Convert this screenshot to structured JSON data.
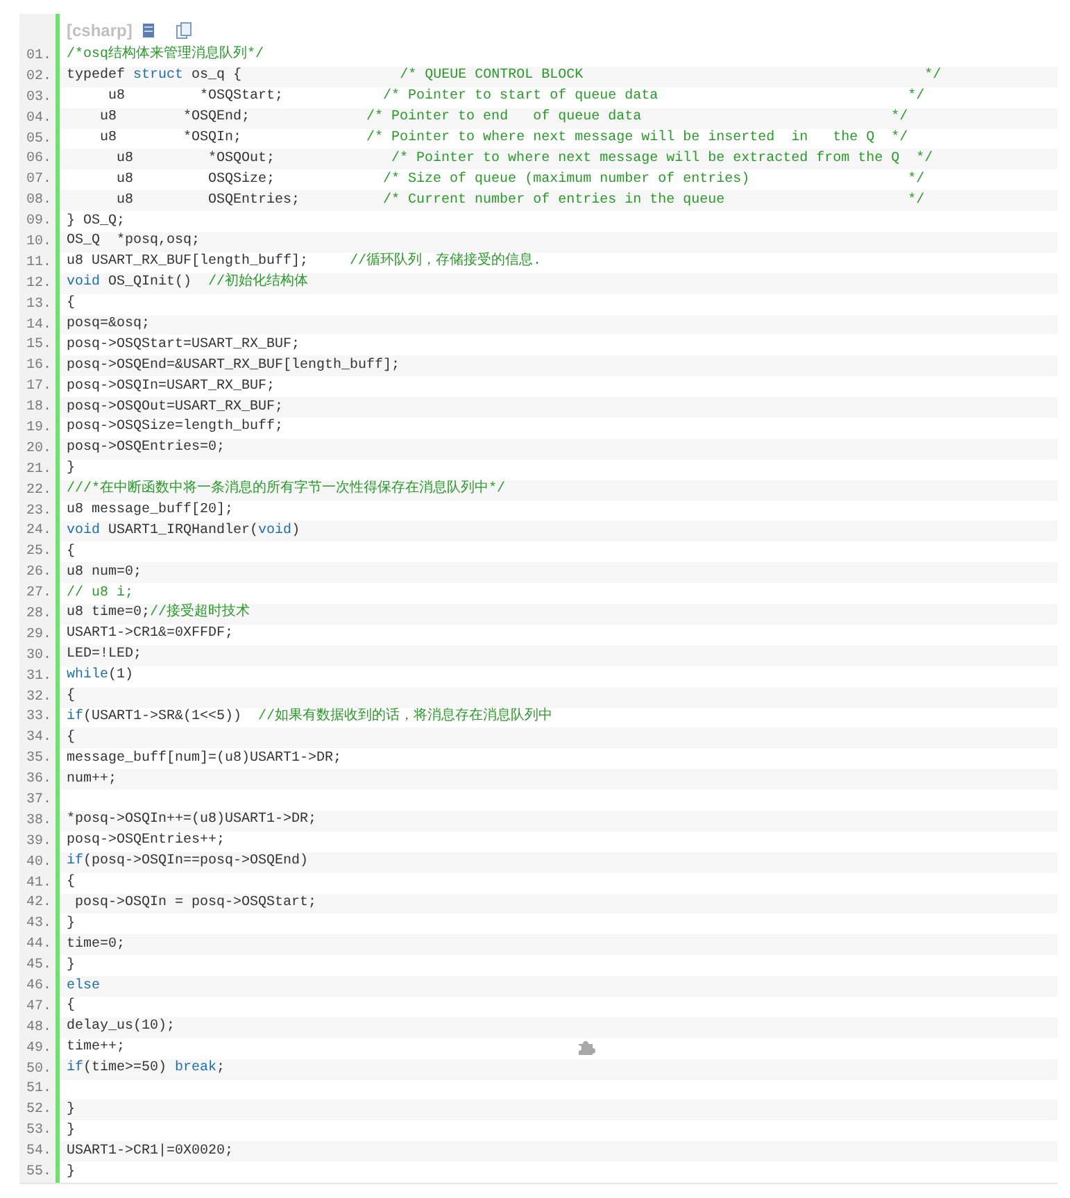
{
  "code_block": {
    "language": "[csharp]",
    "lines": [
      {
        "number": "01.",
        "tokens": [
          {
            "kind": "comment",
            "text": "/*osq结构体来管理消息队列*/"
          }
        ]
      },
      {
        "number": "02.",
        "tokens": [
          {
            "kind": "plain",
            "text": "typedef "
          },
          {
            "kind": "keyword",
            "text": "struct"
          },
          {
            "kind": "plain",
            "text": " os_q {                   "
          },
          {
            "kind": "comment",
            "text": "/* QUEUE CONTROL BLOCK                                         */"
          }
        ]
      },
      {
        "number": "03.",
        "tokens": [
          {
            "kind": "plain",
            "text": "     u8         *OSQStart;            "
          },
          {
            "kind": "comment",
            "text": "/* Pointer to start of queue data                              */"
          }
        ]
      },
      {
        "number": "04.",
        "tokens": [
          {
            "kind": "plain",
            "text": "    u8        *OSQEnd;              "
          },
          {
            "kind": "comment",
            "text": "/* Pointer to end   of queue data                              */"
          }
        ]
      },
      {
        "number": "05.",
        "tokens": [
          {
            "kind": "plain",
            "text": "    u8        *OSQIn;               "
          },
          {
            "kind": "comment",
            "text": "/* Pointer to where next message will be inserted  in   the Q  */"
          }
        ]
      },
      {
        "number": "06.",
        "tokens": [
          {
            "kind": "plain",
            "text": "      u8         *OSQOut;              "
          },
          {
            "kind": "comment",
            "text": "/* Pointer to where next message will be extracted from the Q  */"
          }
        ]
      },
      {
        "number": "07.",
        "tokens": [
          {
            "kind": "plain",
            "text": "      u8         OSQSize;             "
          },
          {
            "kind": "comment",
            "text": "/* Size of queue (maximum number of entries)                   */"
          }
        ]
      },
      {
        "number": "08.",
        "tokens": [
          {
            "kind": "plain",
            "text": "      u8         OSQEntries;          "
          },
          {
            "kind": "comment",
            "text": "/* Current number of entries in the queue                      */"
          }
        ]
      },
      {
        "number": "09.",
        "tokens": [
          {
            "kind": "plain",
            "text": "} OS_Q;"
          }
        ]
      },
      {
        "number": "10.",
        "tokens": [
          {
            "kind": "plain",
            "text": "OS_Q  *posq,osq;"
          }
        ]
      },
      {
        "number": "11.",
        "tokens": [
          {
            "kind": "plain",
            "text": "u8 USART_RX_BUF[length_buff];     "
          },
          {
            "kind": "comment",
            "text": "//循环队列，存储接受的信息."
          }
        ]
      },
      {
        "number": "12.",
        "tokens": [
          {
            "kind": "keyword",
            "text": "void"
          },
          {
            "kind": "plain",
            "text": " OS_QInit()  "
          },
          {
            "kind": "comment",
            "text": "//初始化结构体"
          }
        ]
      },
      {
        "number": "13.",
        "tokens": [
          {
            "kind": "plain",
            "text": "{"
          }
        ]
      },
      {
        "number": "14.",
        "tokens": [
          {
            "kind": "plain",
            "text": "posq=&osq;"
          }
        ]
      },
      {
        "number": "15.",
        "tokens": [
          {
            "kind": "plain",
            "text": "posq->OSQStart=USART_RX_BUF;"
          }
        ]
      },
      {
        "number": "16.",
        "tokens": [
          {
            "kind": "plain",
            "text": "posq->OSQEnd=&USART_RX_BUF[length_buff];"
          }
        ]
      },
      {
        "number": "17.",
        "tokens": [
          {
            "kind": "plain",
            "text": "posq->OSQIn=USART_RX_BUF;"
          }
        ]
      },
      {
        "number": "18.",
        "tokens": [
          {
            "kind": "plain",
            "text": "posq->OSQOut=USART_RX_BUF;"
          }
        ]
      },
      {
        "number": "19.",
        "tokens": [
          {
            "kind": "plain",
            "text": "posq->OSQSize=length_buff;"
          }
        ]
      },
      {
        "number": "20.",
        "tokens": [
          {
            "kind": "plain",
            "text": "posq->OSQEntries=0;"
          }
        ]
      },
      {
        "number": "21.",
        "tokens": [
          {
            "kind": "plain",
            "text": "}"
          }
        ]
      },
      {
        "number": "22.",
        "tokens": [
          {
            "kind": "comment",
            "text": "///*在中断函数中将一条消息的所有字节一次性得保存在消息队列中*/"
          }
        ]
      },
      {
        "number": "23.",
        "tokens": [
          {
            "kind": "plain",
            "text": "u8 message_buff[20];"
          }
        ]
      },
      {
        "number": "24.",
        "tokens": [
          {
            "kind": "keyword",
            "text": "void"
          },
          {
            "kind": "plain",
            "text": " USART1_IRQHandler("
          },
          {
            "kind": "keyword",
            "text": "void"
          },
          {
            "kind": "plain",
            "text": ")"
          }
        ]
      },
      {
        "number": "25.",
        "tokens": [
          {
            "kind": "plain",
            "text": "{"
          }
        ]
      },
      {
        "number": "26.",
        "tokens": [
          {
            "kind": "plain",
            "text": "u8 num=0;"
          }
        ]
      },
      {
        "number": "27.",
        "tokens": [
          {
            "kind": "comment",
            "text": "// u8 i;"
          }
        ]
      },
      {
        "number": "28.",
        "tokens": [
          {
            "kind": "plain",
            "text": "u8 time=0;"
          },
          {
            "kind": "comment",
            "text": "//接受超时技术"
          }
        ]
      },
      {
        "number": "29.",
        "tokens": [
          {
            "kind": "plain",
            "text": "USART1->CR1&=0XFFDF;"
          }
        ]
      },
      {
        "number": "30.",
        "tokens": [
          {
            "kind": "plain",
            "text": "LED=!LED;"
          }
        ]
      },
      {
        "number": "31.",
        "tokens": [
          {
            "kind": "keyword",
            "text": "while"
          },
          {
            "kind": "plain",
            "text": "(1)"
          }
        ]
      },
      {
        "number": "32.",
        "tokens": [
          {
            "kind": "plain",
            "text": "{"
          }
        ]
      },
      {
        "number": "33.",
        "tokens": [
          {
            "kind": "keyword",
            "text": "if"
          },
          {
            "kind": "plain",
            "text": "(USART1->SR&(1<<5))  "
          },
          {
            "kind": "comment",
            "text": "//如果有数据收到的话，将消息存在消息队列中"
          }
        ]
      },
      {
        "number": "34.",
        "tokens": [
          {
            "kind": "plain",
            "text": "{"
          }
        ]
      },
      {
        "number": "35.",
        "tokens": [
          {
            "kind": "plain",
            "text": "message_buff[num]=(u8)USART1->DR;"
          }
        ]
      },
      {
        "number": "36.",
        "tokens": [
          {
            "kind": "plain",
            "text": "num++;"
          }
        ]
      },
      {
        "number": "37."
      },
      {
        "number": "38.",
        "tokens": [
          {
            "kind": "plain",
            "text": "*posq->OSQIn++=(u8)USART1->DR;"
          }
        ]
      },
      {
        "number": "39.",
        "tokens": [
          {
            "kind": "plain",
            "text": "posq->OSQEntries++;"
          }
        ]
      },
      {
        "number": "40.",
        "tokens": [
          {
            "kind": "keyword",
            "text": "if"
          },
          {
            "kind": "plain",
            "text": "(posq->OSQIn==posq->OSQEnd)"
          }
        ]
      },
      {
        "number": "41.",
        "tokens": [
          {
            "kind": "plain",
            "text": "{"
          }
        ]
      },
      {
        "number": "42.",
        "tokens": [
          {
            "kind": "plain",
            "text": " posq->OSQIn = posq->OSQStart;"
          }
        ]
      },
      {
        "number": "43.",
        "tokens": [
          {
            "kind": "plain",
            "text": "}"
          }
        ]
      },
      {
        "number": "44.",
        "tokens": [
          {
            "kind": "plain",
            "text": "time=0;"
          }
        ]
      },
      {
        "number": "45.",
        "tokens": [
          {
            "kind": "plain",
            "text": "}"
          }
        ]
      },
      {
        "number": "46.",
        "tokens": [
          {
            "kind": "keyword",
            "text": "else"
          }
        ]
      },
      {
        "number": "47.",
        "tokens": [
          {
            "kind": "plain",
            "text": "{"
          }
        ]
      },
      {
        "number": "48.",
        "tokens": [
          {
            "kind": "plain",
            "text": "delay_us(10);"
          }
        ]
      },
      {
        "number": "49.",
        "tokens": [
          {
            "kind": "plain",
            "text": "time++;"
          }
        ]
      },
      {
        "number": "50.",
        "tokens": [
          {
            "kind": "keyword",
            "text": "if"
          },
          {
            "kind": "plain",
            "text": "(time>=50) "
          },
          {
            "kind": "keyword",
            "text": "break"
          },
          {
            "kind": "plain",
            "text": ";"
          }
        ]
      },
      {
        "number": "51."
      },
      {
        "number": "52.",
        "tokens": [
          {
            "kind": "plain",
            "text": "}"
          }
        ]
      },
      {
        "number": "53.",
        "tokens": [
          {
            "kind": "plain",
            "text": "}"
          }
        ]
      },
      {
        "number": "54.",
        "tokens": [
          {
            "kind": "plain",
            "text": "USART1->CR1|=0X0020;"
          }
        ]
      },
      {
        "number": "55.",
        "tokens": [
          {
            "kind": "plain",
            "text": "}"
          }
        ]
      }
    ]
  }
}
